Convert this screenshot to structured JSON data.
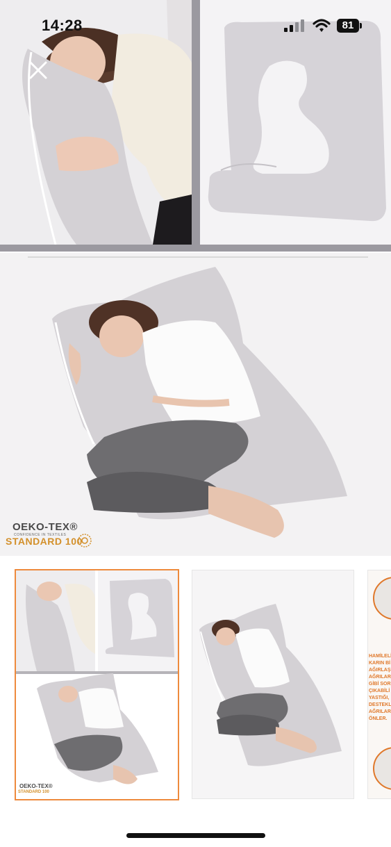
{
  "status_bar": {
    "time": "14:28",
    "battery_level": "81",
    "icons": [
      "signal-icon",
      "wifi-icon",
      "battery-icon"
    ]
  },
  "gallery": {
    "close_icon": "close-icon",
    "badge": {
      "brand": "OEKO-TEX®",
      "tagline": "CONFIDENCE IN TEXTILES",
      "standard": "STANDARD 100"
    }
  },
  "thumbnails": {
    "selected_index": 0,
    "items": [
      {
        "badge_brand": "OEKO-TEX®",
        "badge_standard": "STANDARD 100"
      },
      {},
      {
        "text_lines": [
          "HAMİLELİ",
          "KARIN Bİ",
          "AĞIRLAŞ",
          "AĞRILAR",
          "GİBİ SOR",
          "ÇIKABİLİ",
          "YASTIĞI,",
          "DESTEKL",
          "AĞRILAR",
          "ÖNLER."
        ]
      }
    ]
  },
  "colors": {
    "accent": "#ee8a3c",
    "oeko_orange": "#d3902b",
    "pillow_gray": "#d4d1d5",
    "frame_gray": "#9b99a0"
  }
}
